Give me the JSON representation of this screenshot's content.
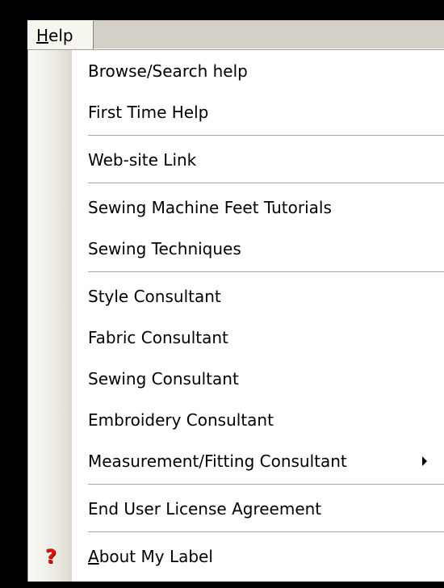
{
  "menubar": {
    "help_label_rest": "elp",
    "help_label_mnemonic": "H"
  },
  "menu": {
    "items": [
      {
        "label": "Browse/Search help"
      },
      {
        "label": "First Time Help"
      },
      {
        "label": "Web-site Link"
      },
      {
        "label": "Sewing Machine Feet Tutorials"
      },
      {
        "label": "Sewing Techniques"
      },
      {
        "label": "Style Consultant"
      },
      {
        "label": "Fabric Consultant"
      },
      {
        "label": "Sewing Consultant"
      },
      {
        "label": "Embroidery Consultant"
      },
      {
        "label": "Measurement/Fitting Consultant",
        "has_submenu": true
      },
      {
        "label": "End User License Agreement"
      },
      {
        "label_mnemonic": "A",
        "label_rest": "bout My Label",
        "icon": "help-question-icon"
      }
    ]
  },
  "colors": {
    "menubar_bg": "#d4d0c8",
    "menu_bg": "#ffffff",
    "gutter": "#ecebe4",
    "separator": "#a6a6a6",
    "help_icon": "#d81414"
  }
}
